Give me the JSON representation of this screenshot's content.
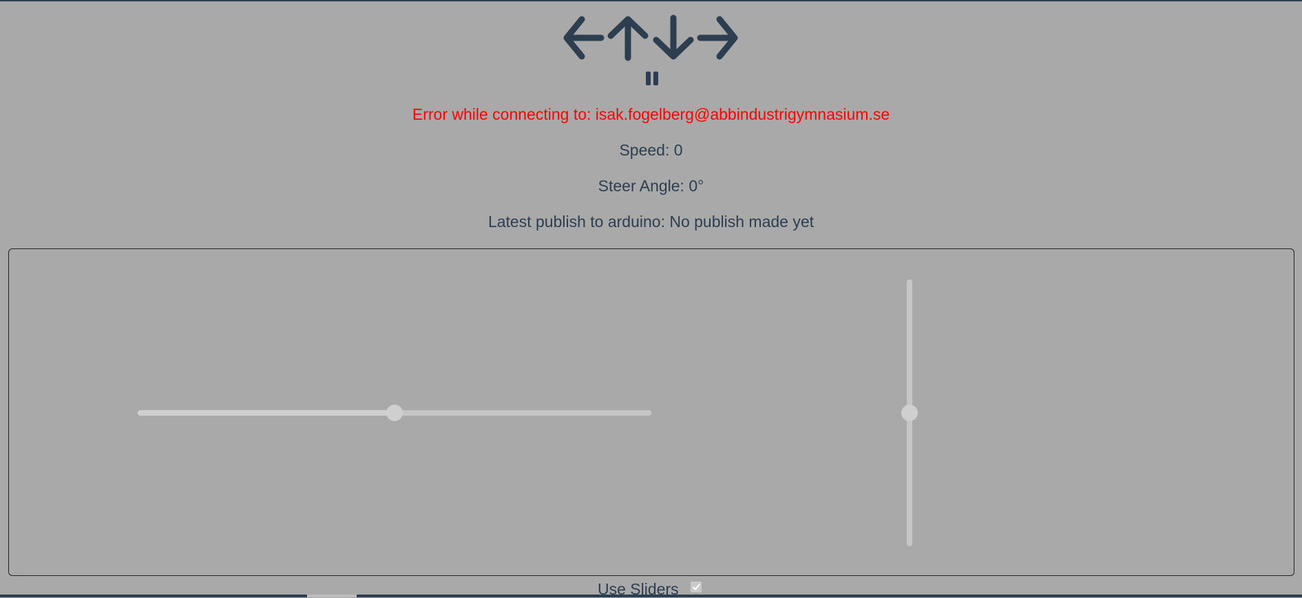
{
  "controls": {
    "icons": [
      "arrow-left-icon",
      "arrow-up-icon",
      "arrow-down-icon",
      "arrow-right-icon",
      "pause-icon"
    ]
  },
  "status": {
    "error": "Error while connecting to: isak.fogelberg@abbindustrigymnasium.se",
    "speed": "Speed: 0",
    "steer_angle": "Steer Angle: 0°",
    "latest_publish": "Latest publish to arduino: No publish made yet"
  },
  "sliders": {
    "steer_slider_position": 0.5,
    "speed_slider_position": 0.5
  },
  "footer": {
    "use_sliders_label": "Use Sliders",
    "use_sliders_checked": true
  },
  "colors": {
    "background": "#a9a9a9",
    "text": "#2c3e50",
    "error": "#ff0000",
    "slider_track": "#c6c6c6"
  }
}
